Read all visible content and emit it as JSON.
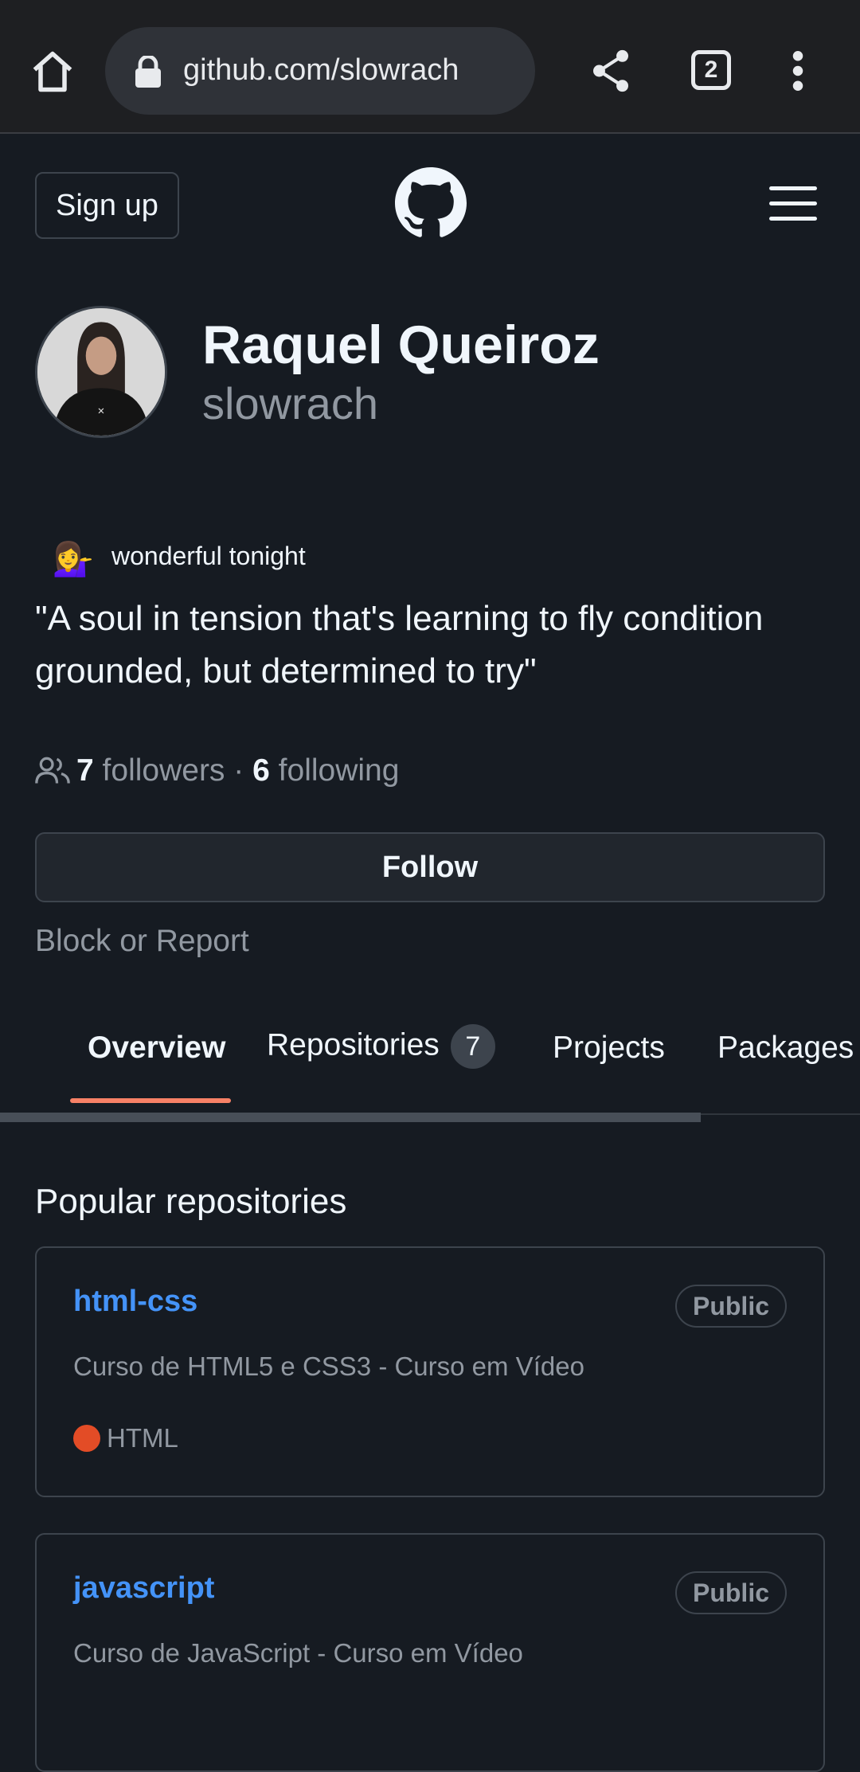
{
  "browser": {
    "url": "github.com/slowrach",
    "tab_count": "2"
  },
  "header": {
    "signup_label": "Sign up"
  },
  "profile": {
    "name": "Raquel Queiroz",
    "login": "slowrach",
    "status_emoji": "💁‍♀️",
    "status_text": "wonderful tonight",
    "bio": "\"A soul in tension that's learning to fly condition grounded, but determined to try\"",
    "followers_count": "7",
    "followers_label": "followers",
    "separator": "·",
    "following_count": "6",
    "following_label": "following",
    "follow_label": "Follow",
    "block_label": "Block or Report"
  },
  "tabs": [
    {
      "label": "Overview"
    },
    {
      "label": "Repositories",
      "count": "7"
    },
    {
      "label": "Projects"
    },
    {
      "label": "Packages"
    }
  ],
  "popular": {
    "title": "Popular repositories",
    "repos": [
      {
        "name": "html-css",
        "visibility": "Public",
        "description": "Curso de HTML5 e CSS3 - Curso em Vídeo",
        "language": "HTML",
        "language_color": "#e34c26"
      },
      {
        "name": "javascript",
        "visibility": "Public",
        "description": "Curso de JavaScript - Curso em Vídeo"
      }
    ]
  },
  "colors": {
    "accent_underline": "#f78166",
    "link": "#4493f8"
  }
}
